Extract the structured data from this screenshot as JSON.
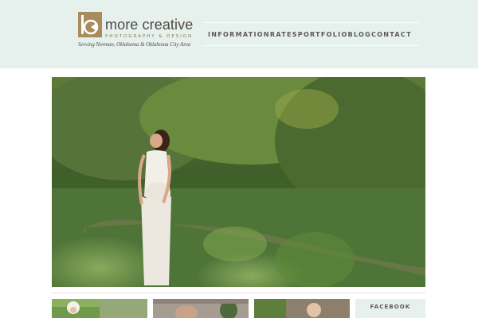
{
  "brand": {
    "name": "more creative",
    "subtitle": "PHOTOGRAPHY & DESIGN",
    "tagline": "Serving Norman, Oklahoma & Oklahoma City Area",
    "icon": "b-camera-logo-icon"
  },
  "nav": {
    "items": [
      {
        "label": "INFORMATION"
      },
      {
        "label": "RATES"
      },
      {
        "label": "PORTFOLIO"
      },
      {
        "label": "BLOG"
      },
      {
        "label": "CONTACT"
      }
    ]
  },
  "sidebar": {
    "facebook_label": "FACEBOOK"
  },
  "colors": {
    "header_bg": "#e6f0ec",
    "logo_gold": "#a88b5f",
    "nav_text": "#5c5a55",
    "divider": "#e9ded7"
  }
}
